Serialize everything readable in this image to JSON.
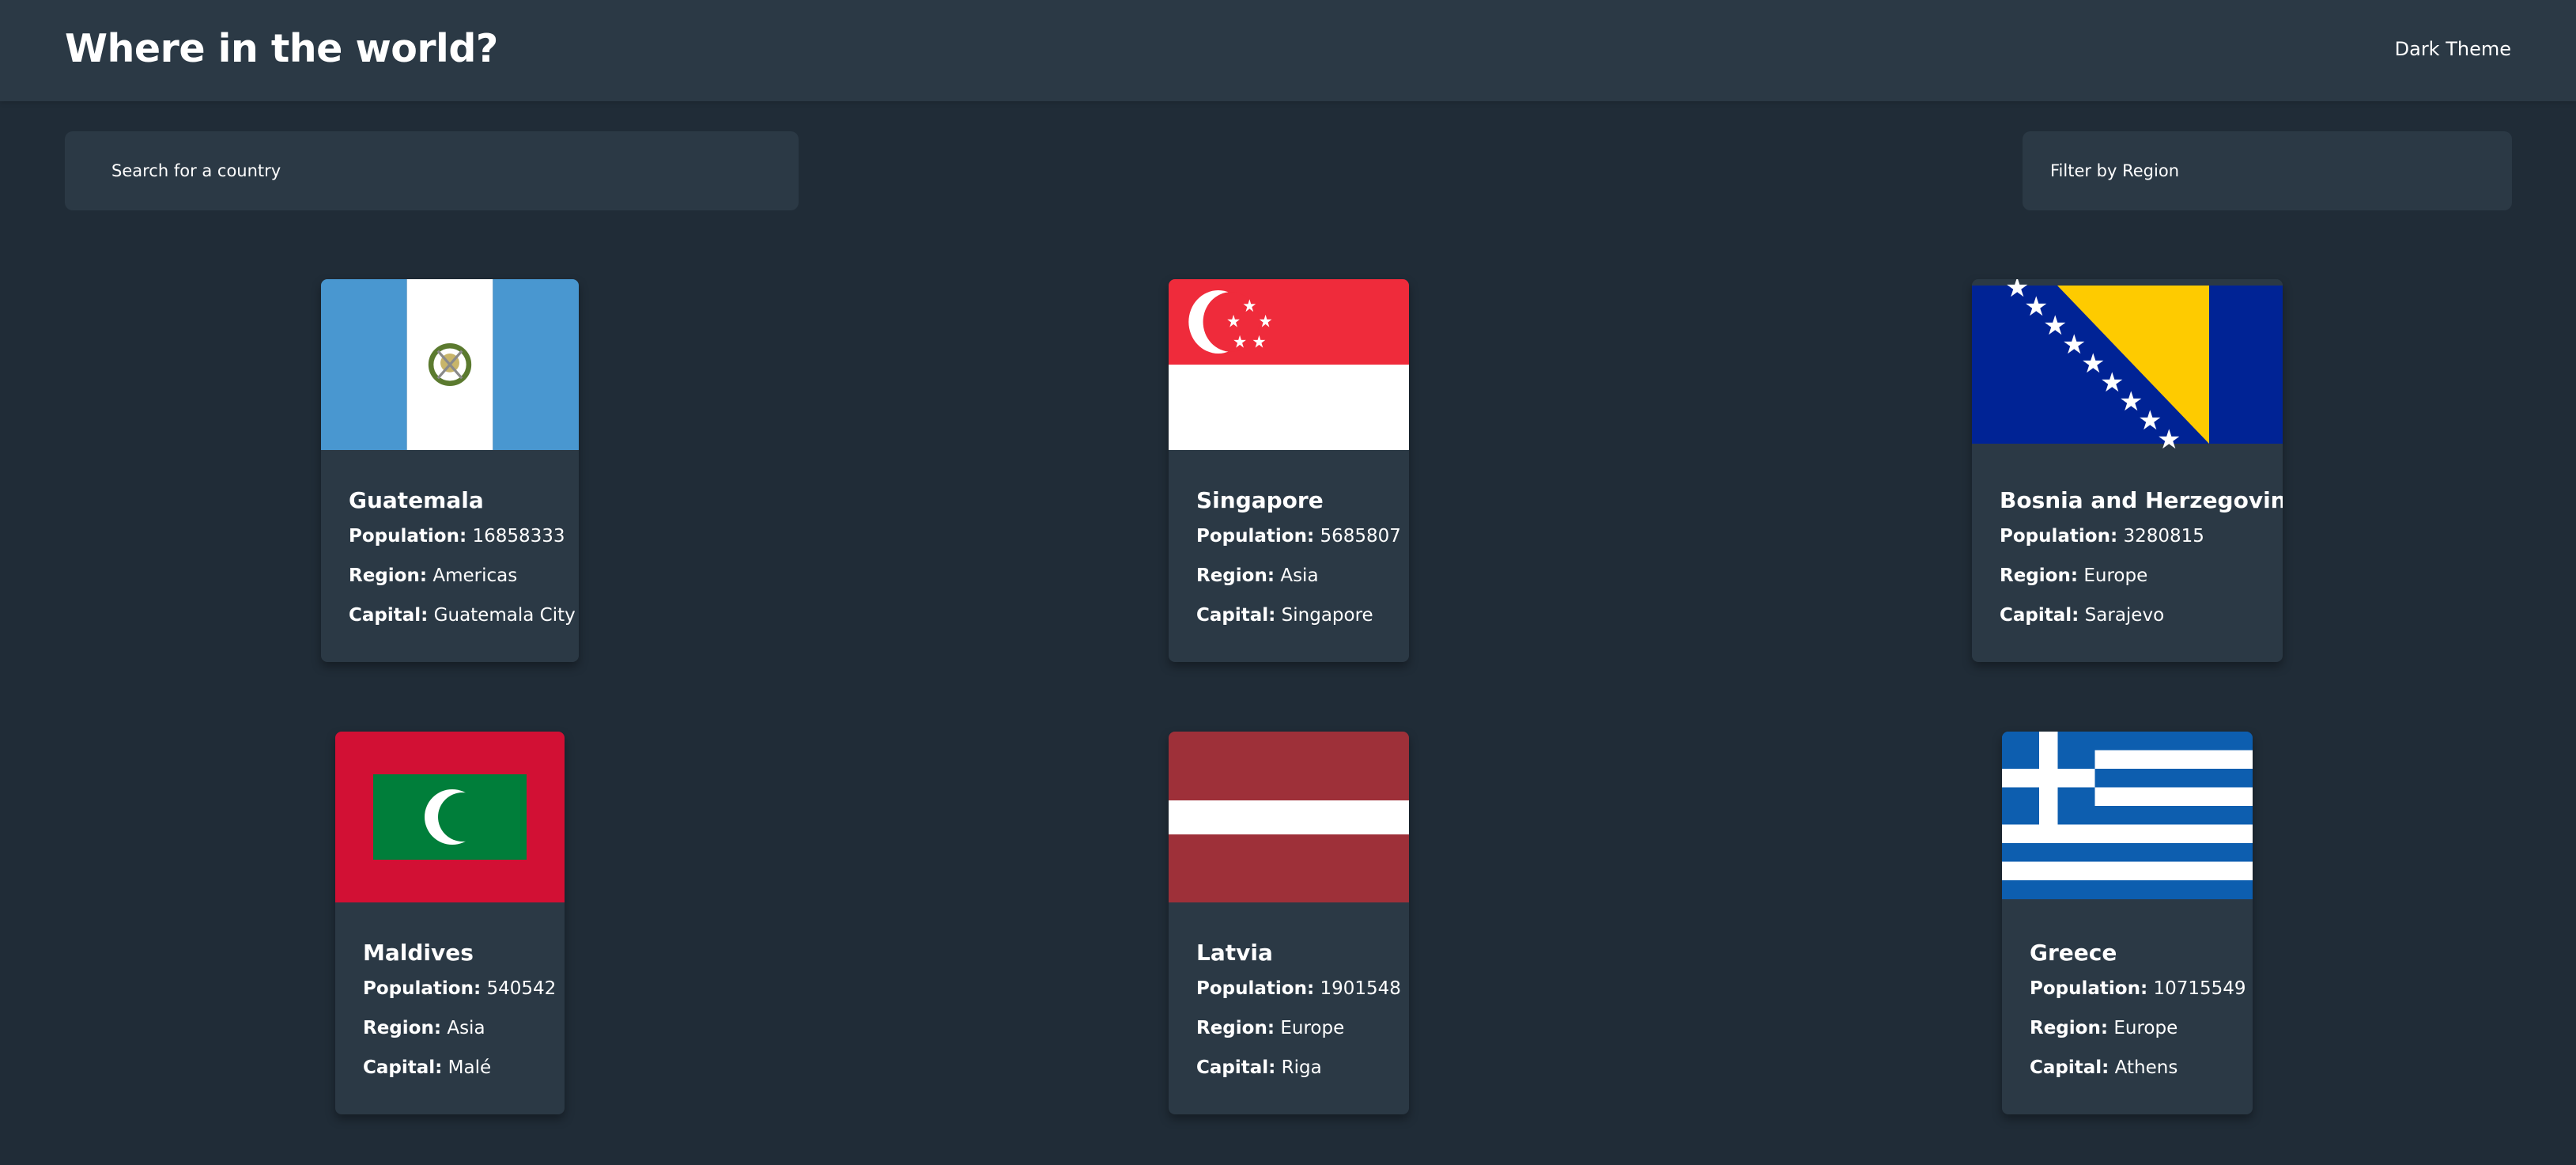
{
  "header": {
    "title": "Where in the world?",
    "theme_toggle": "Dark Theme"
  },
  "search": {
    "placeholder": "Search for a country"
  },
  "filter": {
    "label": "Filter by Region"
  },
  "labels": {
    "population": "Population:",
    "region": "Region:",
    "capital": "Capital:"
  },
  "countries": [
    {
      "name": "Guatemala",
      "population": "16858333",
      "region": "Americas",
      "capital": "Guatemala City",
      "flag_icon": "guatemala-flag"
    },
    {
      "name": "Singapore",
      "population": "5685807",
      "region": "Asia",
      "capital": "Singapore",
      "flag_icon": "singapore-flag"
    },
    {
      "name": "Bosnia and Herzegovina",
      "population": "3280815",
      "region": "Europe",
      "capital": "Sarajevo",
      "flag_icon": "bosnia-flag"
    },
    {
      "name": "Maldives",
      "population": "540542",
      "region": "Asia",
      "capital": "Malé",
      "flag_icon": "maldives-flag"
    },
    {
      "name": "Latvia",
      "population": "1901548",
      "region": "Europe",
      "capital": "Riga",
      "flag_icon": "latvia-flag"
    },
    {
      "name": "Greece",
      "population": "10715549",
      "region": "Europe",
      "capital": "Athens",
      "flag_icon": "greece-flag"
    }
  ],
  "colors": {
    "background": "#202c37",
    "elements": "#2b3945",
    "text": "#ffffff"
  }
}
